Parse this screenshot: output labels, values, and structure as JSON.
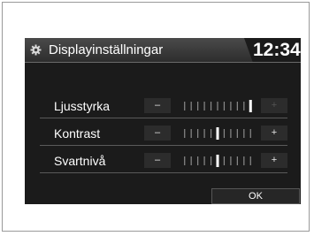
{
  "header": {
    "title": "Displayinställningar",
    "clock": "12:34",
    "icon": "gear-icon"
  },
  "settings": [
    {
      "label": "Ljusstyrka",
      "minus": "–",
      "plus": "+",
      "level": 10,
      "steps": 10,
      "plus_enabled": false
    },
    {
      "label": "Kontrast",
      "minus": "–",
      "plus": "+",
      "level": 5,
      "steps": 10,
      "plus_enabled": true
    },
    {
      "label": "Svartnivå",
      "minus": "–",
      "plus": "+",
      "level": 5,
      "steps": 10,
      "plus_enabled": true
    }
  ],
  "ok_label": "OK",
  "colors": {
    "screen_bg": "#1b1b1b",
    "tick_dim": "#8a8a8a",
    "tick_active": "#ffffff"
  }
}
